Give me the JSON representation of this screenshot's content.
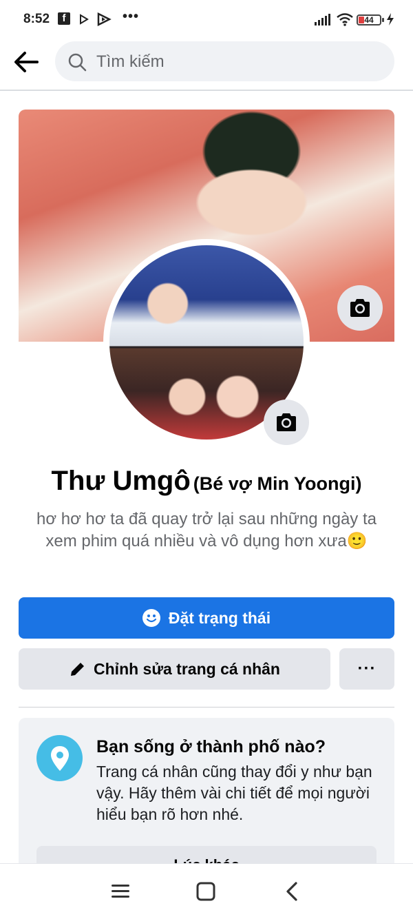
{
  "status_bar": {
    "time": "8:52",
    "battery": "44",
    "icons": [
      "facebook-icon",
      "play-icon",
      "play-store-icon",
      "more-dots",
      "signal-icon",
      "wifi-icon",
      "battery-icon",
      "charging-icon"
    ],
    "overflow_dots": "•••"
  },
  "header": {
    "search_placeholder": "Tìm kiếm",
    "back_icon": "arrow-left-icon"
  },
  "profile": {
    "name": "Thư Umgô",
    "alternate_name": "(Bé vợ Min Yoongi)",
    "bio": "hơ hơ hơ ta đã quay trở lại sau những ngày ta xem phim quá nhiều và vô dụng hơn xưa🙂"
  },
  "actions": {
    "set_status": "Đặt trạng thái",
    "edit_profile": "Chỉnh sửa trang cá nhân",
    "more": "···"
  },
  "prompt_card": {
    "title": "Bạn sống ở thành phố nào?",
    "body": "Trang cá nhân cũng thay đổi y như bạn vậy. Hãy thêm vài chi tiết để mọi người hiểu bạn rõ hơn nhé.",
    "button": "Lúc khác"
  },
  "nav_bar": {
    "icons": [
      "recents-icon",
      "home-icon",
      "back-icon"
    ]
  },
  "colors": {
    "primary": "#1b74e4",
    "secondary_bg": "#e4e6eb",
    "pin_bg": "#45bde6",
    "muted_text": "#65676b"
  }
}
